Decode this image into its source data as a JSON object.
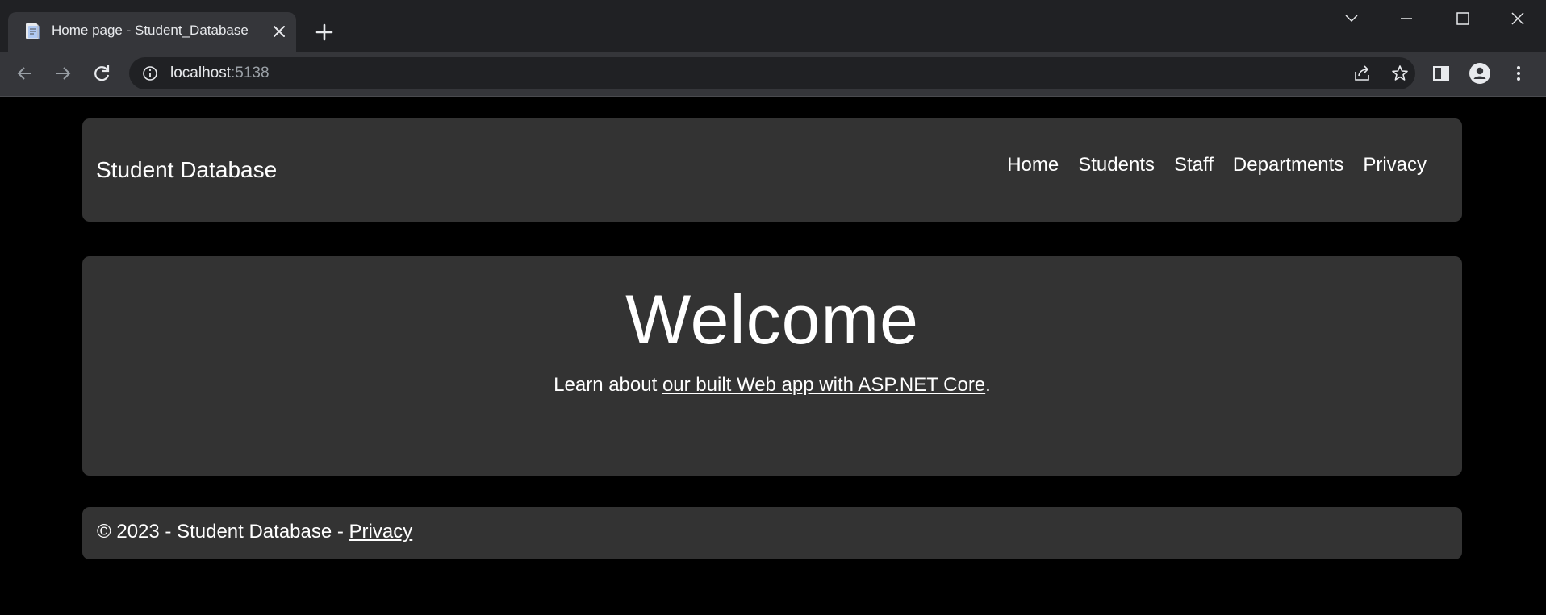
{
  "browser": {
    "tab_title": "Home page - Student_Database",
    "url_host": "localhost",
    "url_port": ":5138",
    "icons": {
      "favicon": "document-icon",
      "tab_close": "close-icon",
      "new_tab": "plus-icon",
      "back": "arrow-left-icon",
      "forward": "arrow-right-icon",
      "reload": "reload-icon",
      "site_info": "info-icon",
      "share": "share-icon",
      "bookmark": "star-icon",
      "side_panel": "side-panel-icon",
      "profile": "profile-icon",
      "menu": "kebab-menu-icon",
      "tab_search": "chevron-down-icon",
      "minimize": "minimize-icon",
      "maximize": "maximize-icon",
      "close_window": "close-icon"
    }
  },
  "navbar": {
    "brand": "Student Database",
    "links": [
      "Home",
      "Students",
      "Staff",
      "Departments",
      "Privacy"
    ]
  },
  "hero": {
    "heading": "Welcome",
    "text_before": "Learn about ",
    "link_text": "our built Web app with ASP.NET Core",
    "text_after": "."
  },
  "footer": {
    "text": "© 2023 - Student Database - ",
    "link_text": "Privacy"
  },
  "colors": {
    "page_background": "#000000",
    "card_background": "#333333",
    "chrome_dark": "#202124",
    "chrome_light": "#35363a",
    "text": "#ffffff"
  }
}
